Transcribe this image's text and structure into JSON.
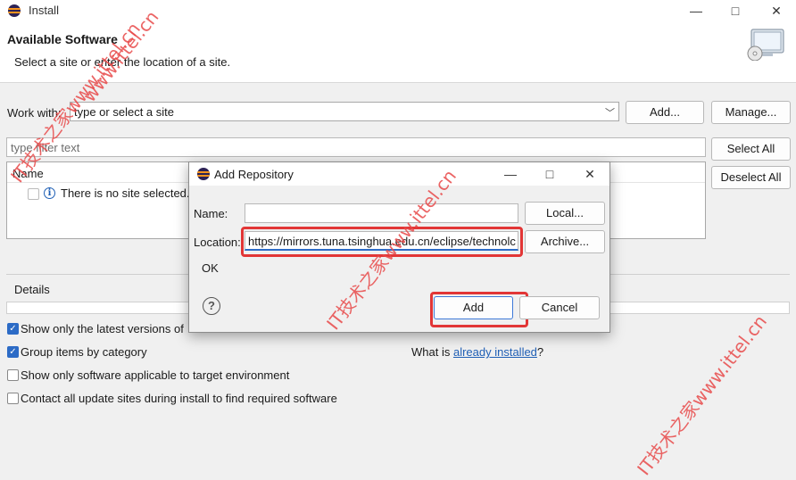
{
  "window": {
    "title": "Install",
    "minimize": "—",
    "maximize": "□",
    "close": "✕"
  },
  "header": {
    "title": "Available Software",
    "subtitle": "Select a site or enter the location of a site."
  },
  "work_with": {
    "label": "Work with:",
    "combo_value": "type or select a site",
    "add_label": "Add...",
    "manage_label": "Manage..."
  },
  "filter": {
    "placeholder": "type filter text",
    "select_all_label": "Select All",
    "deselect_all_label": "Deselect All"
  },
  "tree": {
    "column_name": "Name",
    "empty_message": "There is no site selected."
  },
  "details": {
    "label": "Details"
  },
  "options": {
    "latest_versions": {
      "label": "Show only the latest versions of",
      "checked": true
    },
    "group_by_category": {
      "label": "Group items by category",
      "checked": true
    },
    "applicable_only": {
      "label": "Show only software applicable to target environment",
      "checked": false
    },
    "contact_update_sites": {
      "label": "Contact all update sites during install to find required software",
      "checked": false
    },
    "what_is_prefix": "What is ",
    "already_installed_link": "already installed",
    "what_is_suffix": "?"
  },
  "dialog": {
    "title": "Add Repository",
    "name_label": "Name:",
    "name_value": "",
    "local_label": "Local...",
    "location_label": "Location:",
    "location_value": "https://mirrors.tuna.tsinghua.edu.cn/eclipse/technolc",
    "archive_label": "Archive...",
    "status_text": "OK",
    "add_label": "Add",
    "cancel_label": "Cancel"
  },
  "watermark": {
    "texts": [
      "www.ittel.cn",
      "IT技术之家www.ittel.cn",
      "IT技术之家www.ittel.cn",
      "IT技术之家www.ittel.cn"
    ]
  },
  "colors": {
    "accent": "#2c6bc6",
    "highlight_box": "#e23636",
    "link": "#1f5fb5"
  }
}
